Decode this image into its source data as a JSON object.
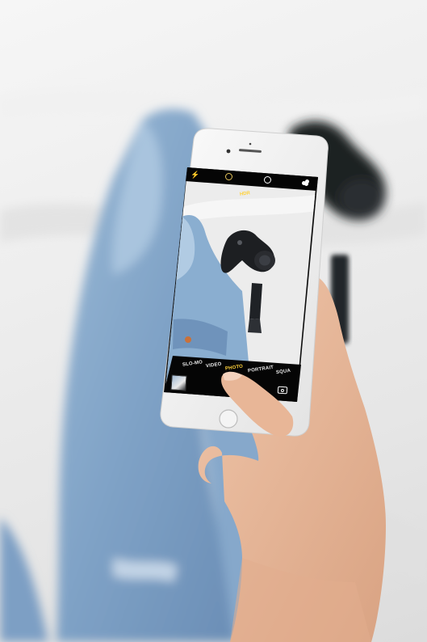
{
  "photo": {
    "subject": "hand holding smartphone photographing denim jacket and camera",
    "colors": {
      "sheet": "#ececec",
      "denim": "#8fb0cf",
      "denim_dark": "#5f7fa3",
      "phone_body": "#f4f4f4",
      "skin": "#e8b89b",
      "camera_black": "#1d1f22"
    }
  },
  "camera_app": {
    "top_bar": {
      "icons": [
        "flash-icon",
        "live-photo-icon",
        "timer-icon",
        "filter-icon"
      ]
    },
    "hdr_label": "HDR",
    "modes": [
      {
        "label": "SLO-MO",
        "active": false
      },
      {
        "label": "VIDEO",
        "active": false
      },
      {
        "label": "PHOTO",
        "active": true
      },
      {
        "label": "PORTRAIT",
        "active": false
      },
      {
        "label": "SQUA",
        "active": false
      }
    ],
    "bottom_bar": {
      "icons": [
        "thumbnail-icon",
        "shutter-button",
        "switch-camera-icon"
      ]
    }
  }
}
